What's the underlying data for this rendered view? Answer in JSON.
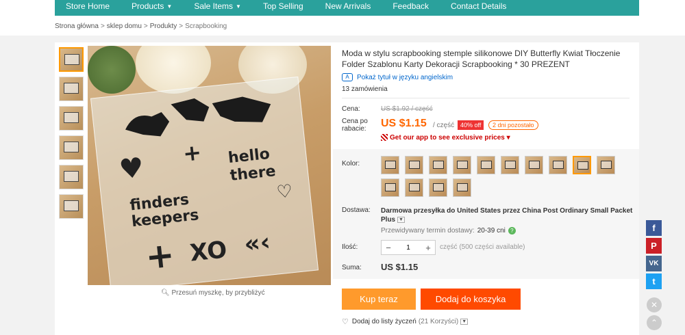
{
  "nav": {
    "items": [
      {
        "label": "Store Home",
        "dropdown": false
      },
      {
        "label": "Products",
        "dropdown": true
      },
      {
        "label": "Sale Items",
        "dropdown": true
      },
      {
        "label": "Top Selling",
        "dropdown": false
      },
      {
        "label": "New Arrivals",
        "dropdown": false
      },
      {
        "label": "Feedback",
        "dropdown": false
      },
      {
        "label": "Contact Details",
        "dropdown": false
      }
    ]
  },
  "breadcrumb": [
    "Strona główna",
    "sklep domu",
    "Produkty",
    "Scrapbooking"
  ],
  "gallery": {
    "zoom_hint": "Przesuń myszkę, by przybliżyć",
    "stamp_words": [
      "finders keepers",
      "hello there",
      "XO"
    ]
  },
  "product": {
    "title": "Moda w stylu scrapbooking stemple silikonowe DIY Butterfly Kwiat Tłoczenie Folder Szablonu Karty Dekoracji Scrapbooking * 30 PREZENT",
    "translate_link": "Pokaż tytuł w języku angielskim",
    "orders": "13 zamówienia"
  },
  "pricing": {
    "price_label": "Cena:",
    "old_price": "US $1.92 / część",
    "sale_label": "Cena po rabacie:",
    "sale_price": "US $1.15",
    "unit": "/ część",
    "discount": "40% off",
    "days_left": "2 dni pozostało",
    "app_promo": "Get our app to see exclusive prices"
  },
  "options": {
    "color_label": "Kolor:",
    "swatch_count": 14,
    "selected_swatch": 8,
    "shipping_label": "Dostawa:",
    "shipping_text": "Darmowa przesyłka do United States przez China Post Ordinary Small Packet Plus",
    "eta_label": "Przewidywany termin dostawy:",
    "eta_value": "20-39 cni",
    "qty_label": "Ilość:",
    "qty_value": "1",
    "qty_avail": "część (500 części available)",
    "total_label": "Suma:",
    "total_value": "US $1.15"
  },
  "actions": {
    "buy_now": "Kup teraz",
    "add_to_cart": "Dodaj do koszyka",
    "wishlist": "Dodaj do listy życzeń",
    "wishlist_count": "(21 Korzyści)"
  },
  "colors": {
    "nav_bg": "#2aa19c",
    "buy_now": "#ff9a2c",
    "add_to_cart": "#ff4a00",
    "price": "#ff6600",
    "facebook": "#3b5998",
    "pinterest": "#cb2027",
    "vk": "#45668e",
    "twitter": "#1da1f2"
  }
}
